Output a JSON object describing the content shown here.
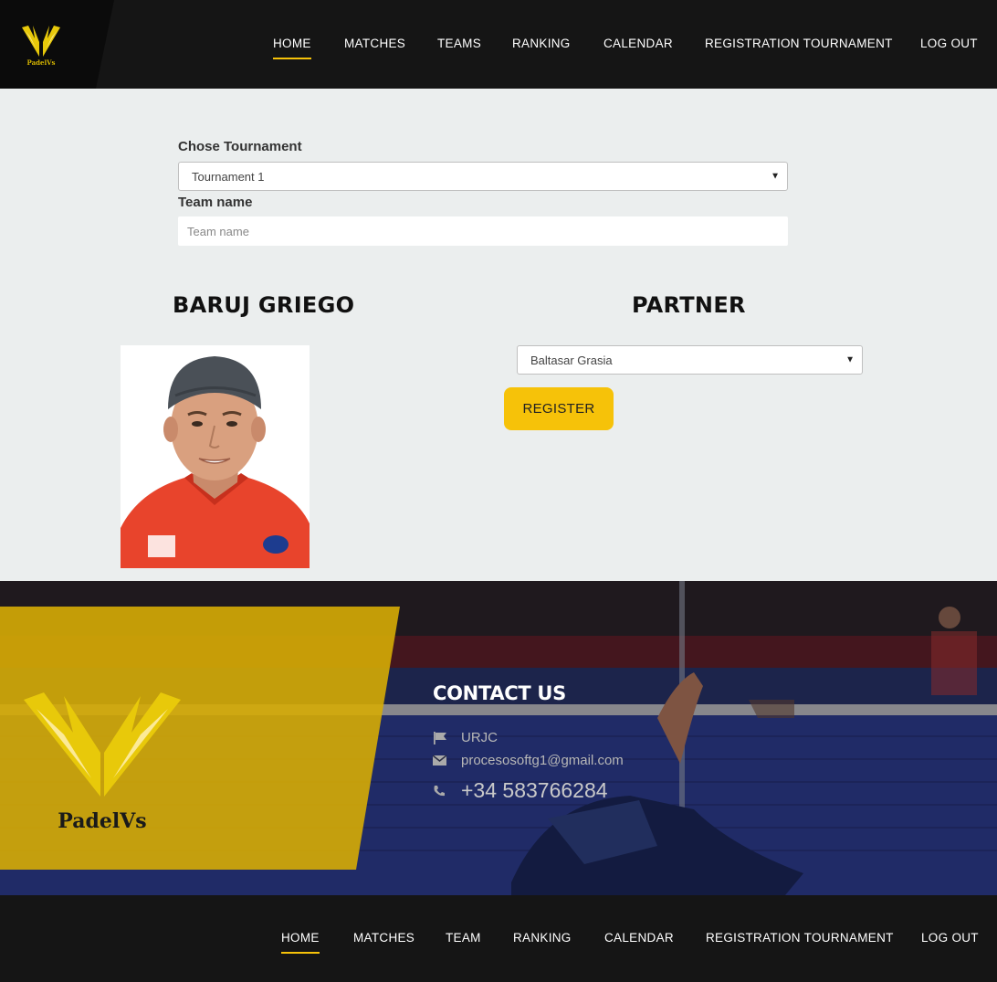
{
  "header": {
    "logo_text": "PadelVs",
    "nav": [
      {
        "label": "HOME",
        "active": true
      },
      {
        "label": "MATCHES",
        "active": false
      },
      {
        "label": "TEAMS",
        "active": false
      },
      {
        "label": "RANKING",
        "active": false
      },
      {
        "label": "CALENDAR",
        "active": false
      },
      {
        "label": "REGISTRATION TOURNAMENT",
        "active": false
      },
      {
        "label": "LOG OUT",
        "active": false
      }
    ]
  },
  "form": {
    "tournament_label": "Chose Tournament",
    "tournament_value": "Tournament 1",
    "team_name_label": "Team name",
    "team_name_placeholder": "Team name",
    "team_name_value": ""
  },
  "player": {
    "name": "BARUJ GRIEGO"
  },
  "partner": {
    "heading": "PARTNER",
    "selected": "Baltasar Grasia",
    "register_label": "REGISTER"
  },
  "contact": {
    "title": "CONTACT US",
    "address": "URJC",
    "email": "procesosoftg1@gmail.com",
    "phone": "+34 583766284",
    "logo_text": "PadelVs"
  },
  "footer": {
    "nav": [
      {
        "label": "HOME",
        "active": true
      },
      {
        "label": "MATCHES",
        "active": false
      },
      {
        "label": "TEAM",
        "active": false
      },
      {
        "label": "RANKING",
        "active": false
      },
      {
        "label": "CALENDAR",
        "active": false
      },
      {
        "label": "REGISTRATION TOURNAMENT",
        "active": false
      },
      {
        "label": "LOG OUT",
        "active": false
      }
    ]
  },
  "colors": {
    "accent": "#f6c209",
    "header_bg": "#151515",
    "page_bg": "#ebeeee"
  }
}
